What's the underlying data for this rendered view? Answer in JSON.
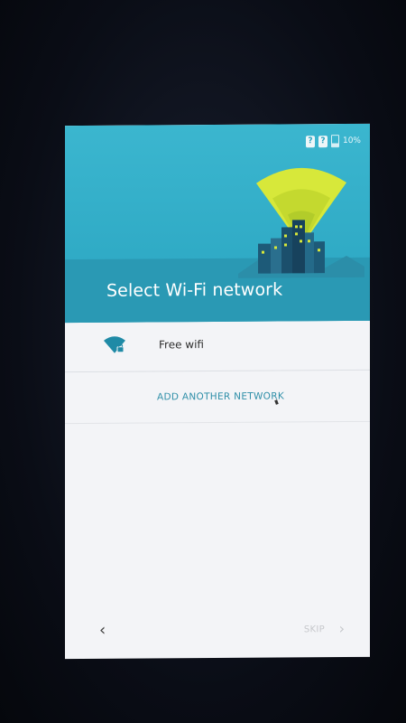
{
  "status_bar": {
    "sim1_label": "?",
    "sim2_label": "?",
    "battery_text": "10%"
  },
  "header": {
    "title": "Select Wi-Fi network",
    "illustration": "wifi-city-icon"
  },
  "networks": [
    {
      "name": "Free wifi",
      "icon": "wifi-locked-icon"
    }
  ],
  "add_network_label": "ADD ANOTHER NETWORK",
  "footer": {
    "back_icon": "chevron-left-icon",
    "skip_label": "SKIP",
    "forward_icon": "chevron-right-icon"
  },
  "colors": {
    "header": "#2aa5c1",
    "accent": "#2f8fa8",
    "beam": "#d7e83a"
  }
}
